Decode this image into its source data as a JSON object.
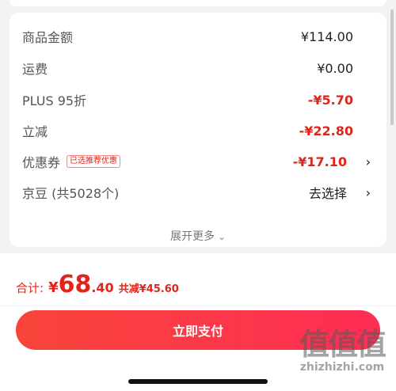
{
  "summary": {
    "rows": [
      {
        "label": "商品金额",
        "value": "¥114.00"
      },
      {
        "label": "运费",
        "value": "¥0.00"
      },
      {
        "label": "PLUS 95折",
        "value": "-¥5.70"
      },
      {
        "label": "立减",
        "value": "-¥22.80"
      },
      {
        "label": "优惠券",
        "tag": "已选推荐优惠",
        "value": "-¥17.10",
        "arrow": "›"
      },
      {
        "label": "京豆 (共5028个)",
        "value": "去选择",
        "arrow": "›"
      }
    ],
    "expand_label": "展开更多",
    "expand_icon": "⌄"
  },
  "footer": {
    "total_label": "合计:",
    "currency": "¥",
    "total_int": "68",
    "total_dec": ".40",
    "savings": "共减¥45.60",
    "pay_button": "立即支付"
  },
  "watermark": {
    "logo": "值值值",
    "url": "zhizhizhi.com"
  },
  "colors": {
    "accent": "#e2231a",
    "button_start": "#f8453a",
    "button_end": "#ff2d55"
  }
}
